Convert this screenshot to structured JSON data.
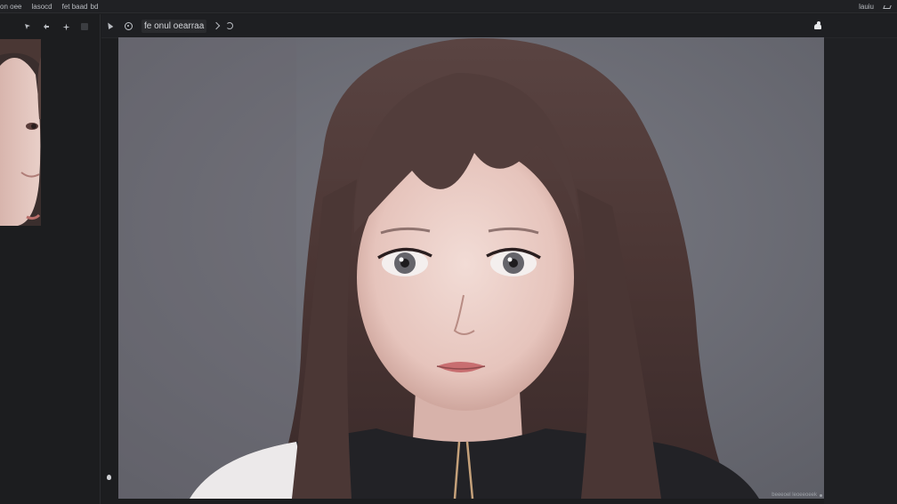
{
  "menubar": {
    "items": [
      "on oee",
      "lasocd",
      "fet baad",
      "bd"
    ],
    "right_label": "lauiu"
  },
  "left_panel": {
    "tools": [
      "cursor-icon",
      "move-icon",
      "sparkle-icon",
      "square-icon"
    ]
  },
  "main_toolbar": {
    "title": "fe onul oearraa"
  },
  "canvas": {
    "status_text": "beeeoel leoeeoeek"
  },
  "colors": {
    "background": "#1c1d1f",
    "canvas_bg": "#6f7079",
    "text": "#c9cbcf"
  }
}
